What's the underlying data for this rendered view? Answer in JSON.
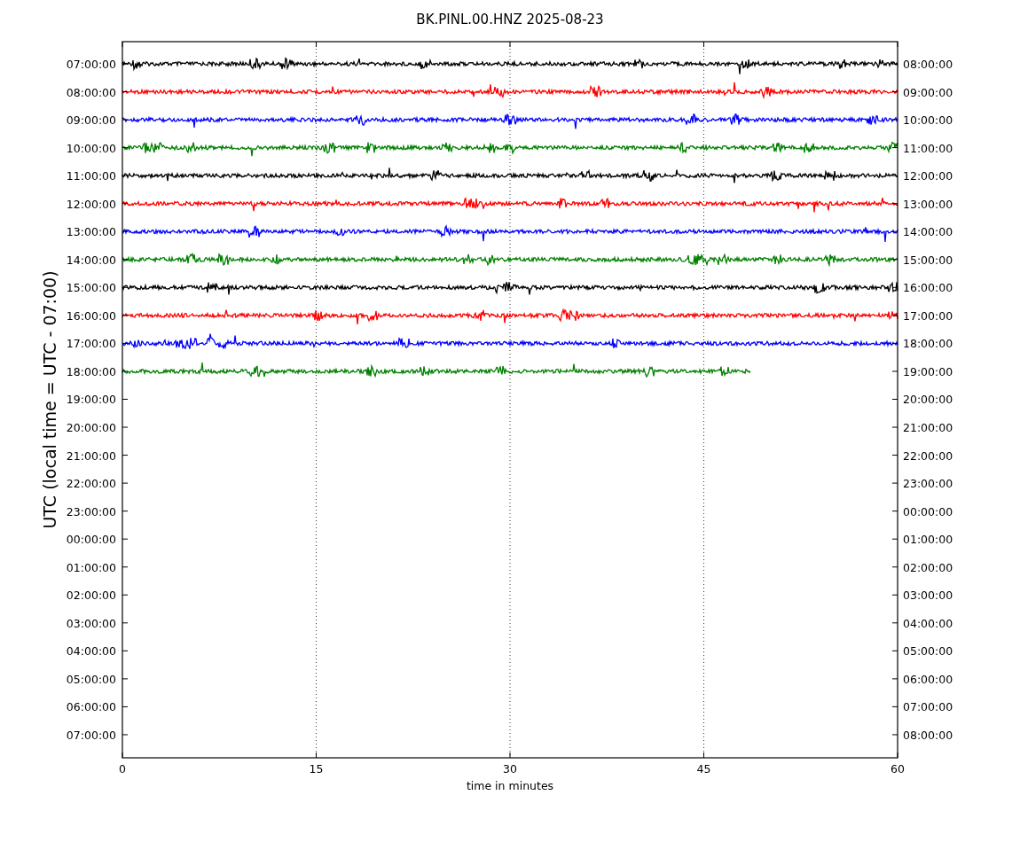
{
  "title": "BK.PINL.00.HNZ 2025-08-23",
  "y_label": "UTC (local time = UTC - 07:00)",
  "x_label": "time in minutes",
  "x_ticks": [
    "0",
    "15",
    "30",
    "45",
    "60"
  ],
  "left_labels": [
    "07:00:00",
    "08:00:00",
    "09:00:00",
    "10:00:00",
    "11:00:00",
    "12:00:00",
    "13:00:00",
    "14:00:00",
    "15:00:00",
    "16:00:00",
    "17:00:00",
    "18:00:00",
    "19:00:00",
    "20:00:00",
    "21:00:00",
    "22:00:00",
    "23:00:00",
    "00:00:00",
    "01:00:00",
    "02:00:00",
    "03:00:00",
    "04:00:00",
    "05:00:00",
    "06:00:00",
    "07:00:00"
  ],
  "right_labels": [
    "08:00:00",
    "09:00:00",
    "10:00:00",
    "11:00:00",
    "12:00:00",
    "13:00:00",
    "14:00:00",
    "15:00:00",
    "16:00:00",
    "17:00:00",
    "18:00:00",
    "19:00:00",
    "20:00:00",
    "21:00:00",
    "22:00:00",
    "23:00:00",
    "00:00:00",
    "01:00:00",
    "02:00:00",
    "03:00:00",
    "04:00:00",
    "05:00:00",
    "06:00:00",
    "07:00:00",
    "08:00:00"
  ],
  "traces": [
    {
      "color": "#000000",
      "level": 1
    },
    {
      "color": "#ff0000",
      "level": 1
    },
    {
      "color": "#0000ff",
      "level": 1
    },
    {
      "color": "#008000",
      "level": 1
    },
    {
      "color": "#000000",
      "level": 1
    },
    {
      "color": "#ff0000",
      "level": 1
    },
    {
      "color": "#0000ff",
      "level": 1
    },
    {
      "color": "#008000",
      "level": 1
    },
    {
      "color": "#000000",
      "level": 1
    },
    {
      "color": "#ff0000",
      "level": 1
    },
    {
      "color": "#0000ff",
      "level": 1
    },
    {
      "color": "#008000",
      "level": 0.81
    }
  ]
}
